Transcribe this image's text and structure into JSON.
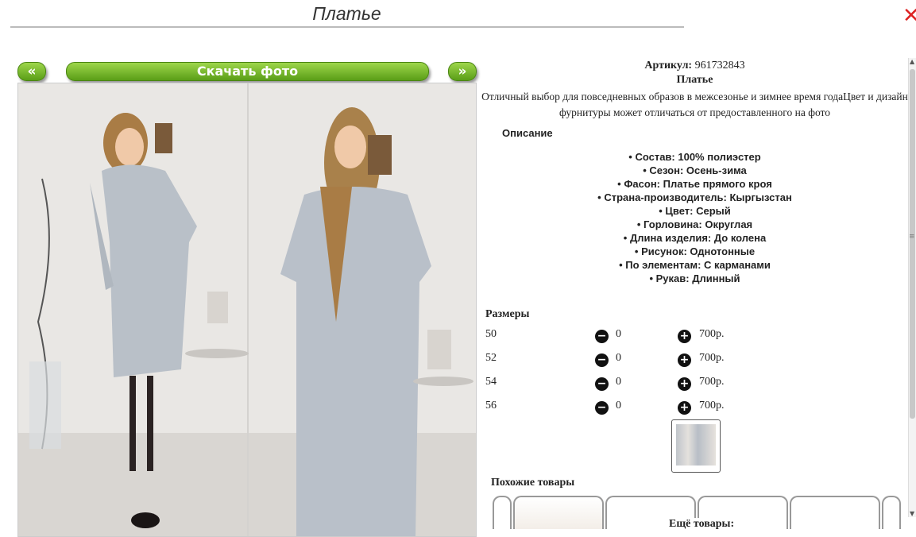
{
  "header": {
    "title": "Платье",
    "close_icon": "close-icon"
  },
  "gallery": {
    "prev_label": "«",
    "download_label": "Скачать фото",
    "next_label": "»"
  },
  "product": {
    "article_label": "Артикул:",
    "article_value": "961732843",
    "name": "Платье",
    "description": "Отличный выбор для повседневных образов в межсезонье и зимнее время годаЦвет и дизайн фурнитуры может отличаться от предоставленного на фото",
    "description_heading": "Описание",
    "properties": [
      "Состав: 100% полиэстер",
      "Сезон: Осень-зима",
      "Фасон: Платье прямого кроя",
      "Страна-производитель: Кыргызстан",
      "Цвет: Серый",
      "Горловина: Округлая",
      "Длина изделия: До колена",
      "Рисунок: Однотонные",
      "По элементам: С карманами",
      "Рукав: Длинный"
    ]
  },
  "sizes": {
    "heading": "Размеры",
    "rows": [
      {
        "size": "50",
        "qty": "0",
        "price": "700р."
      },
      {
        "size": "52",
        "qty": "0",
        "price": "700р."
      },
      {
        "size": "54",
        "qty": "0",
        "price": "700р."
      },
      {
        "size": "56",
        "qty": "0",
        "price": "700р."
      }
    ],
    "minus_icon": "minus-circle-icon",
    "plus_icon": "plus-circle-icon"
  },
  "similar": {
    "heading": "Похожие товары"
  },
  "more": {
    "heading": "Ещё товары:"
  },
  "colors": {
    "accent_green": "#6db42a",
    "close_red": "#dd2222"
  }
}
